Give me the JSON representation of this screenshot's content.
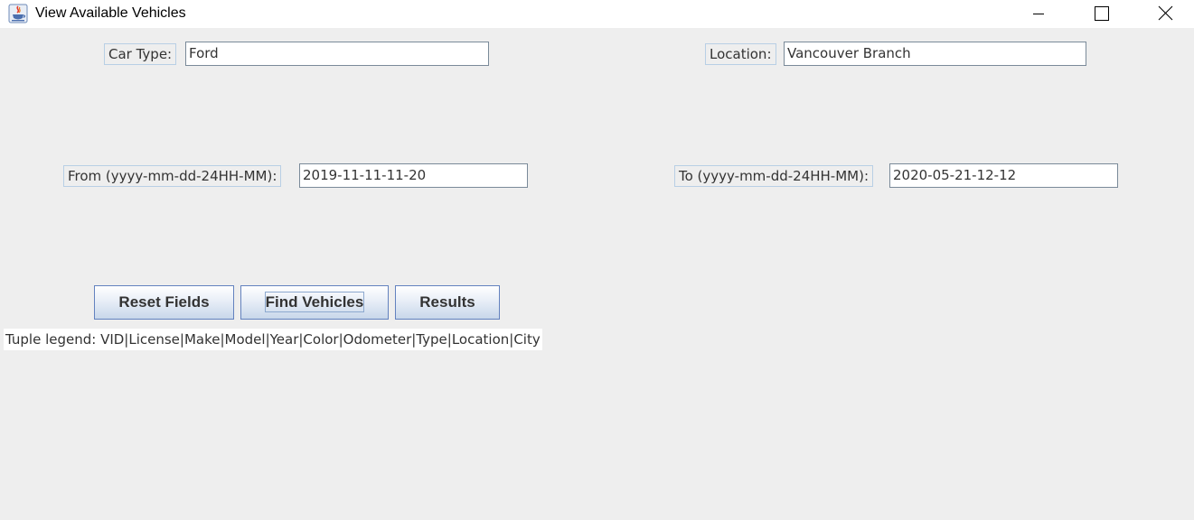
{
  "window": {
    "title": "View Available Vehicles",
    "icon": "java-coffee-cup-icon"
  },
  "form": {
    "car_type": {
      "label": "Car Type:",
      "value": "Ford"
    },
    "location": {
      "label": "Location:",
      "value": "Vancouver Branch"
    },
    "from": {
      "label": "From (yyyy-mm-dd-24HH-MM):",
      "value": "2019-11-11-11-20"
    },
    "to": {
      "label": "To (yyyy-mm-dd-24HH-MM):",
      "value": "2020-05-21-12-12"
    }
  },
  "buttons": {
    "reset": "Reset Fields",
    "find": "Find Vehicles",
    "results": "Results"
  },
  "legend": "Tuple legend: VID|License|Make|Model|Year|Color|Odometer|Type|Location|City",
  "colors": {
    "background": "#eeeeee",
    "label_border": "#b8cfe5",
    "button_border": "#6382bf",
    "button_gradient_bottom": "#c8d7ea"
  }
}
